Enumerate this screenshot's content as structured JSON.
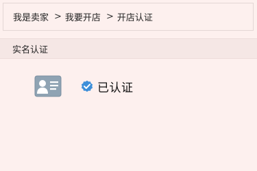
{
  "breadcrumb": {
    "items": [
      "我是卖家",
      "我要开店",
      "开店认证"
    ],
    "separator": ">"
  },
  "section": {
    "title": "实名认证"
  },
  "verification": {
    "status_text": "已认证",
    "icon": "id-card-icon",
    "badge_icon": "verified-badge-icon",
    "badge_color": "#3d8fd9"
  }
}
